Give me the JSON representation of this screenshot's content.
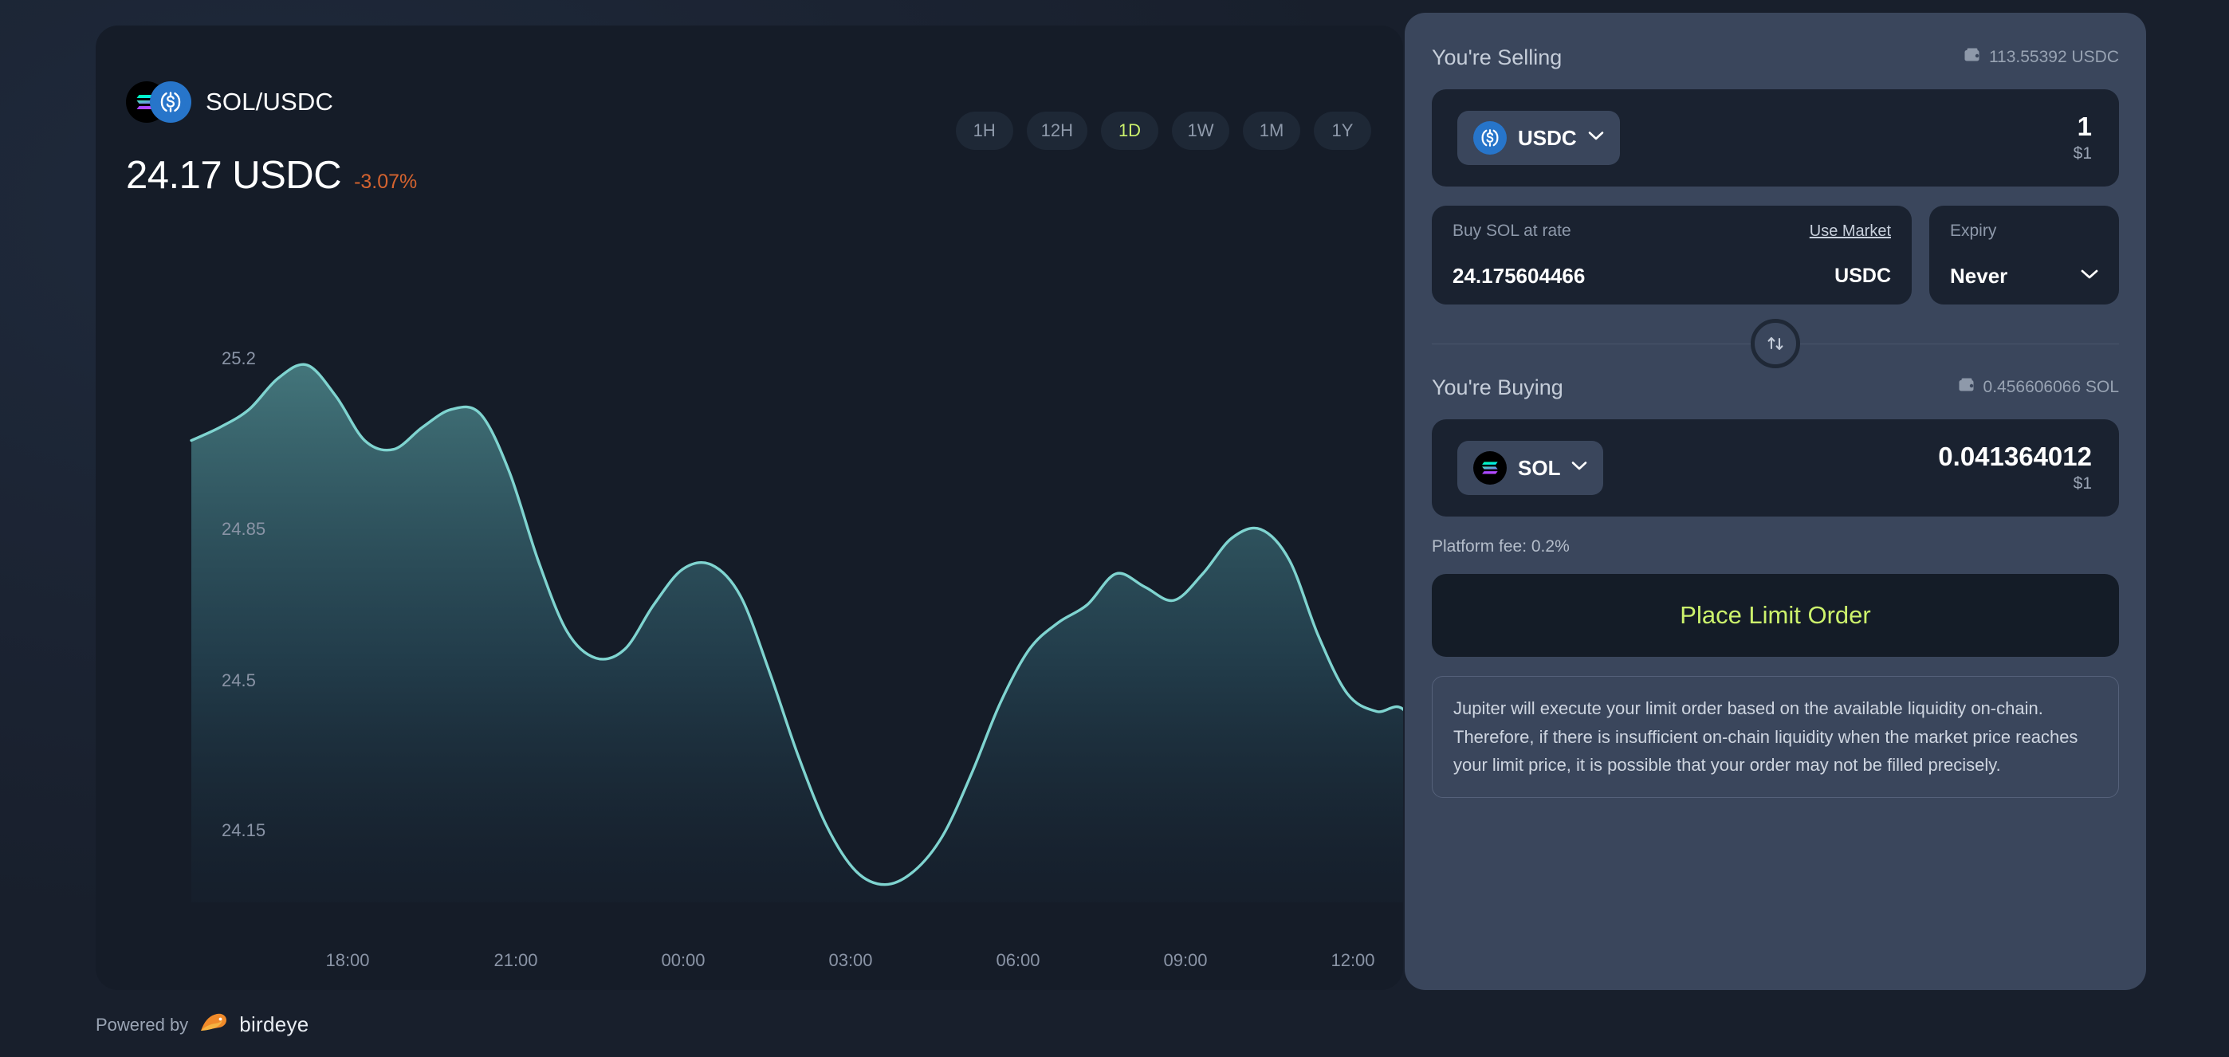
{
  "chart_card": {
    "pair_name": "SOL/USDC",
    "price_value": "24.17 USDC",
    "price_change": "-3.07%",
    "sol_icon": "solana-logo-icon",
    "usdc_icon": "usdc-logo-icon",
    "ranges": [
      {
        "label": "1H",
        "active": false
      },
      {
        "label": "12H",
        "active": false
      },
      {
        "label": "1D",
        "active": true
      },
      {
        "label": "1W",
        "active": false
      },
      {
        "label": "1M",
        "active": false
      },
      {
        "label": "1Y",
        "active": false
      }
    ],
    "footer": {
      "powered_by": "Powered by",
      "provider": "birdeye",
      "provider_icon": "bird-logo-icon"
    }
  },
  "chart_data": {
    "type": "area",
    "title": "SOL/USDC",
    "xlabel": "",
    "ylabel": "",
    "grid": false,
    "legend": null,
    "line_color": "#7fd4d0",
    "fill_color": "#2f5560",
    "marker_color": "#ccf26c",
    "ylim": [
      23.95,
      25.35
    ],
    "yticks": [
      "25.2",
      "24.85",
      "24.5",
      "24.15"
    ],
    "ytick_values": [
      25.2,
      24.85,
      24.5,
      24.15
    ],
    "xticks": [
      "18:00",
      "21:00",
      "00:00",
      "03:00",
      "06:00",
      "09:00",
      "12:00"
    ],
    "x": [
      0,
      1,
      2,
      3,
      4,
      5,
      6,
      7,
      8,
      9,
      10,
      11,
      12,
      13,
      14,
      15,
      16,
      17,
      18,
      19,
      20,
      21,
      22,
      23,
      24,
      25,
      26,
      27,
      28,
      29,
      30,
      31,
      32,
      33,
      34,
      35,
      36,
      37,
      38,
      39,
      40,
      41,
      42,
      43,
      44
    ],
    "values": [
      24.99,
      25.02,
      25.06,
      25.13,
      25.16,
      25.09,
      24.99,
      24.97,
      25.02,
      25.06,
      25.05,
      24.92,
      24.72,
      24.56,
      24.5,
      24.52,
      24.62,
      24.7,
      24.71,
      24.64,
      24.47,
      24.28,
      24.12,
      24.02,
      23.99,
      24.02,
      24.1,
      24.24,
      24.4,
      24.52,
      24.58,
      24.62,
      24.69,
      24.66,
      24.63,
      24.69,
      24.77,
      24.79,
      24.72,
      24.55,
      24.42,
      24.38,
      24.38,
      24.22,
      24.17
    ],
    "end_marker_value": 24.17
  },
  "order_panel": {
    "selling": {
      "title": "You're Selling",
      "balance": "113.55392 USDC",
      "wallet_icon": "wallet-icon",
      "token": "USDC",
      "token_icon": "usdc-logo-icon",
      "chevron_icon": "chevron-down-icon",
      "amount": "1",
      "amount_usd": "$1"
    },
    "rate": {
      "label": "Buy SOL at rate",
      "use_market": "Use Market",
      "value": "24.175604466",
      "unit": "USDC"
    },
    "expiry": {
      "label": "Expiry",
      "value": "Never",
      "chevron_icon": "chevron-down-icon"
    },
    "swap_icon": "swap-vertical-icon",
    "buying": {
      "title": "You're Buying",
      "balance": "0.456606066 SOL",
      "wallet_icon": "wallet-icon",
      "token": "SOL",
      "token_icon": "solana-logo-icon",
      "chevron_icon": "chevron-down-icon",
      "amount": "0.041364012",
      "amount_usd": "$1"
    },
    "platform_fee": "Platform fee: 0.2%",
    "place_order_label": "Place Limit Order",
    "disclaimer": "Jupiter will execute your limit order based on the available liquidity on-chain. Therefore, if there is insufficient on-chain liquidity when the market price reaches your limit price, it is possible that your order may not be filled precisely."
  },
  "colors": {
    "accent_green": "#ccf26c",
    "negative": "#d4632f",
    "chart_line": "#7fd4d0",
    "usdc_blue": "#2775ca",
    "panel_bg": "#3a465c",
    "card_bg": "#151c28"
  }
}
